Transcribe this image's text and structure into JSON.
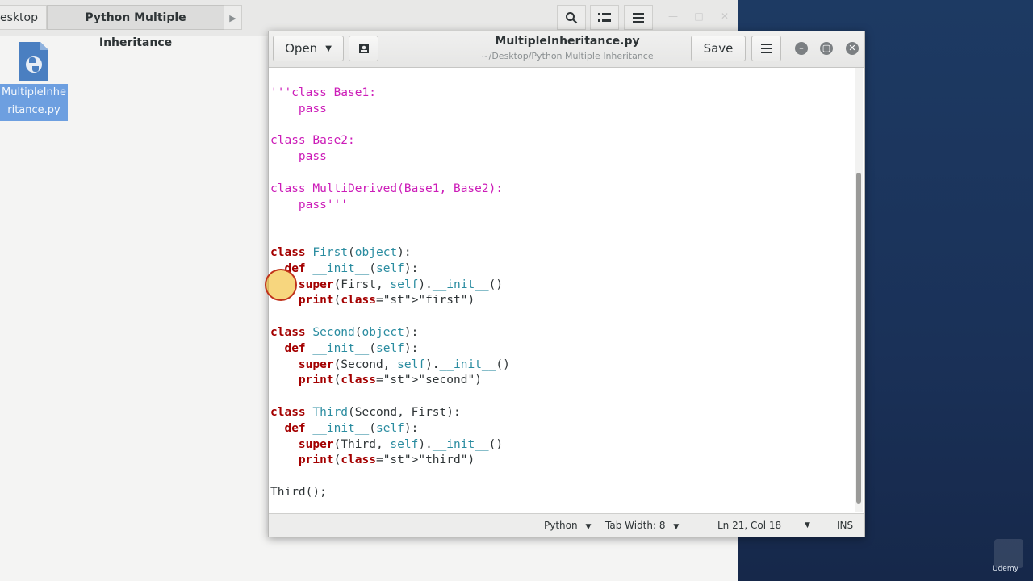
{
  "file_manager": {
    "breadcrumb_prev": "esktop",
    "breadcrumb_current": "Python Multiple Inheritance",
    "file_label": "MultipleInheritance.py"
  },
  "editor": {
    "open_label": "Open",
    "save_label": "Save",
    "title": "MultipleInheritance.py",
    "subtitle": "~/Desktop/Python Multiple Inheritance"
  },
  "code_lines": [
    "'''class Base1:",
    "    pass",
    "",
    "class Base2:",
    "    pass",
    "",
    "class MultiDerived(Base1, Base2):",
    "    pass'''",
    "",
    "",
    "class First(object):",
    "  def __init__(self):",
    "    super(First, self).__init__()",
    "    print(\"first\")",
    "",
    "class Second(object):",
    "  def __init__(self):",
    "    super(Second, self).__init__()",
    "    print(\"second\")",
    "",
    "class Third(Second, First):",
    "  def __init__(self):",
    "    super(Third, self).__init__()",
    "    print(\"third\")",
    "",
    "Third();"
  ],
  "statusbar": {
    "language": "Python",
    "tab_width": "Tab Width: 8",
    "position": "Ln 21, Col 18",
    "mode": "INS"
  },
  "watermark": "Udemy",
  "colors": {
    "keyword": "#a40000",
    "string": "#cc1cb8",
    "builtin": "#2a8ca0",
    "selection": "#6d9fe0"
  },
  "icons": [
    "search-icon",
    "view-options-icon",
    "menu-icon",
    "bookmark-icon",
    "minimize-icon",
    "maximize-icon",
    "close-icon",
    "python-file-icon",
    "chevron-right-icon",
    "dropdown-caret-icon"
  ]
}
